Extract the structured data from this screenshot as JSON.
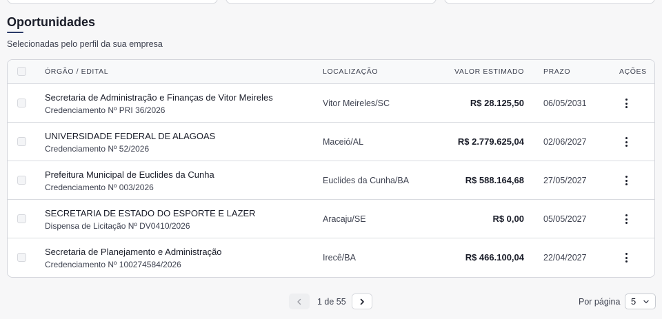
{
  "section": {
    "title": "Oportunidades",
    "subtitle": "Selecionadas pelo perfil da sua empresa"
  },
  "table": {
    "headers": {
      "orgao": "ÓRGÃO / EDITAL",
      "localizacao": "LOCALIZAÇÃO",
      "valor": "VALOR ESTIMADO",
      "prazo": "PRAZO",
      "acoes": "AÇÕES"
    },
    "rows": [
      {
        "orgao": "Secretaria de Administração e Finanças de Vitor Meireles",
        "edital": "Credenciamento Nº PRI 36/2026",
        "localizacao": "Vitor Meireles/SC",
        "valor": "R$ 28.125,50",
        "prazo": "06/05/2031"
      },
      {
        "orgao": "UNIVERSIDADE FEDERAL DE ALAGOAS",
        "edital": "Credenciamento Nº 52/2026",
        "localizacao": "Maceió/AL",
        "valor": "R$ 2.779.625,04",
        "prazo": "02/06/2027"
      },
      {
        "orgao": "Prefeitura Municipal de Euclides da Cunha",
        "edital": "Credenciamento Nº 003/2026",
        "localizacao": "Euclides da Cunha/BA",
        "valor": "R$ 588.164,68",
        "prazo": "27/05/2027"
      },
      {
        "orgao": "SECRETARIA DE ESTADO DO ESPORTE E LAZER",
        "edital": "Dispensa de Licitação Nº DV0410/2026",
        "localizacao": "Aracaju/SE",
        "valor": "R$ 0,00",
        "prazo": "05/05/2027"
      },
      {
        "orgao": "Secretaria de Planejamento e Administração",
        "edital": "Credenciamento Nº 100274584/2026",
        "localizacao": "Irecê/BA",
        "valor": "R$ 466.100,04",
        "prazo": "22/04/2027"
      }
    ]
  },
  "pagination": {
    "page_text": "1 de 55",
    "prev_icon": "chevron-left-icon",
    "next_icon": "chevron-right-icon",
    "per_page_label": "Por página",
    "per_page_value": "5"
  }
}
